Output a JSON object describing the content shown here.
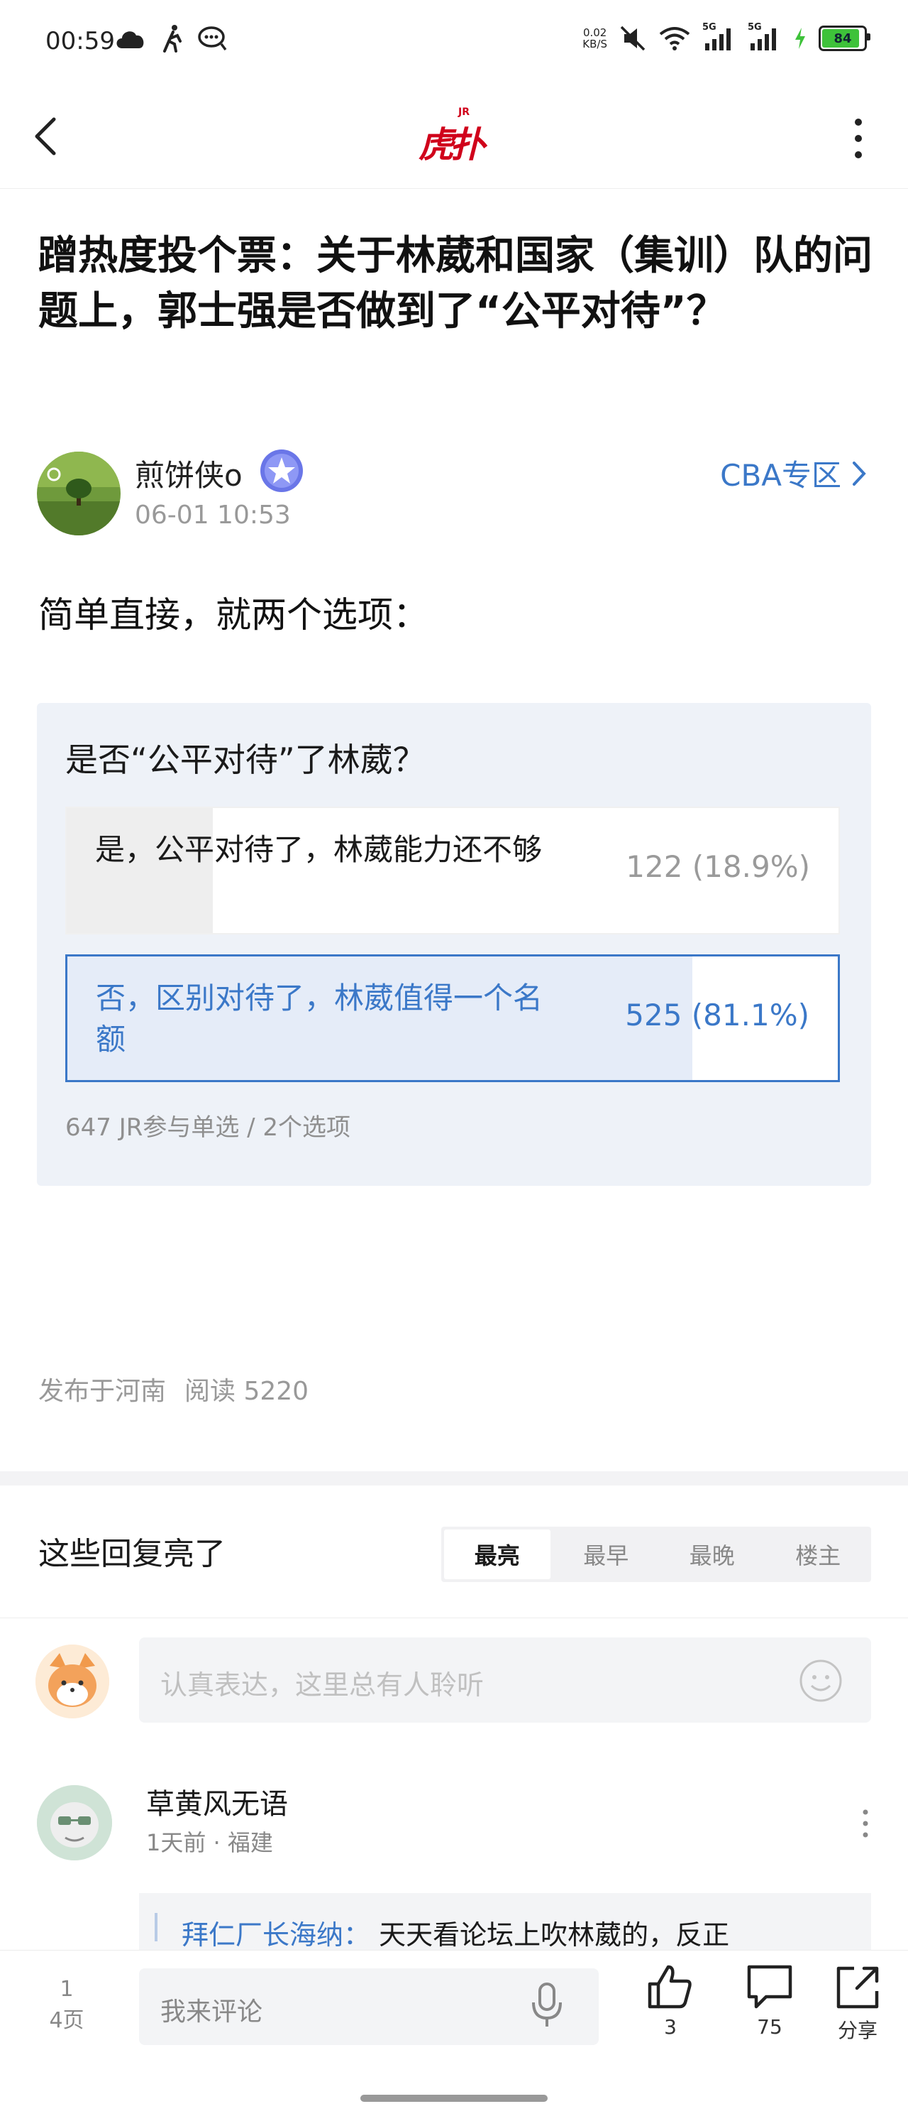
{
  "status_bar": {
    "time": "00:59",
    "net_speed": "0.02",
    "net_unit": "KB/S",
    "signal1": "5G",
    "signal2": "5G",
    "battery": "84"
  },
  "app": {
    "logo_text": "虎扑",
    "logo_sup": "JR"
  },
  "post": {
    "title": "蹭热度投个票：关于林葳和国家（集训）队的问题上，郭士强是否做到了“公平对待”？",
    "author": "煎饼侠o",
    "date": "06-01 10:53",
    "topic": "CBA专区",
    "body": "简单直接，就两个选项："
  },
  "poll": {
    "question": "是否“公平对待”了林葳？",
    "options": [
      {
        "label": "是，公平对待了，林葳能力还不够",
        "value": "122 (18.9%)",
        "fraction": 0.189
      },
      {
        "label": "否，区别对待了，林葳值得一个名额",
        "value": "525 (81.1%)",
        "fraction": 0.811
      }
    ],
    "meta": "647 JR参与单选 / 2个选项"
  },
  "publish": {
    "location": "发布于河南",
    "reads": "阅读 5220"
  },
  "replies": {
    "title": "这些回复亮了",
    "sort_tabs": [
      "最亮",
      "最早",
      "最晚",
      "楼主"
    ],
    "active_tab": "最亮",
    "input_placeholder": "认真表达，这里总有人聆听",
    "first_reply": {
      "name": "草黄风无语",
      "meta": "1天前 · 福建",
      "quote_name": "拜仁厂长海纳：",
      "quote_text": "天天看论坛上吹林葳的，反正"
    }
  },
  "bottom_bar": {
    "page_current": "1",
    "page_total": "4页",
    "input_placeholder": "我来评论",
    "likes": "3",
    "comments": "75",
    "share": "分享"
  }
}
